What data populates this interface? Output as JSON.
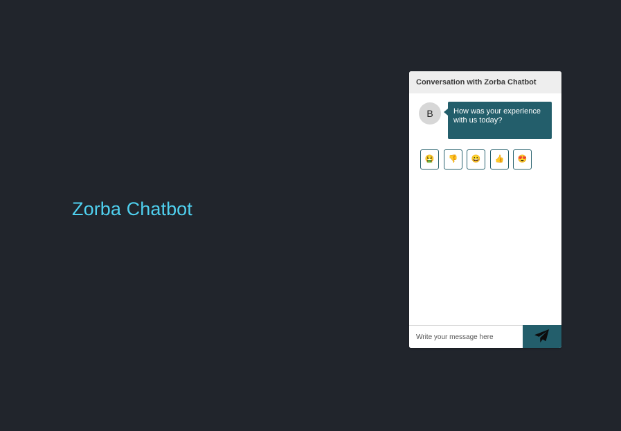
{
  "app": {
    "title": "Zorba Chatbot"
  },
  "chat": {
    "header_title": "Conversation with Zorba Chatbot",
    "bot_avatar_letter": "B",
    "message": "How was your experience with us today?",
    "rating_options": [
      {
        "icon": "nauseated-face-icon",
        "glyph": "🤮"
      },
      {
        "icon": "thumbs-down-icon",
        "glyph": "👎"
      },
      {
        "icon": "slightly-smiling-face-icon",
        "glyph": "😀"
      },
      {
        "icon": "thumbs-up-icon",
        "glyph": "👍"
      },
      {
        "icon": "heart-eyes-face-icon",
        "glyph": "😍"
      }
    ],
    "input": {
      "placeholder": "Write your message here",
      "value": ""
    },
    "send_icon": "paper-plane-icon"
  },
  "colors": {
    "page_background": "#21252c",
    "title_color": "#4fd0ef",
    "accent": "#235e6b",
    "header_background": "#eeeeee"
  }
}
